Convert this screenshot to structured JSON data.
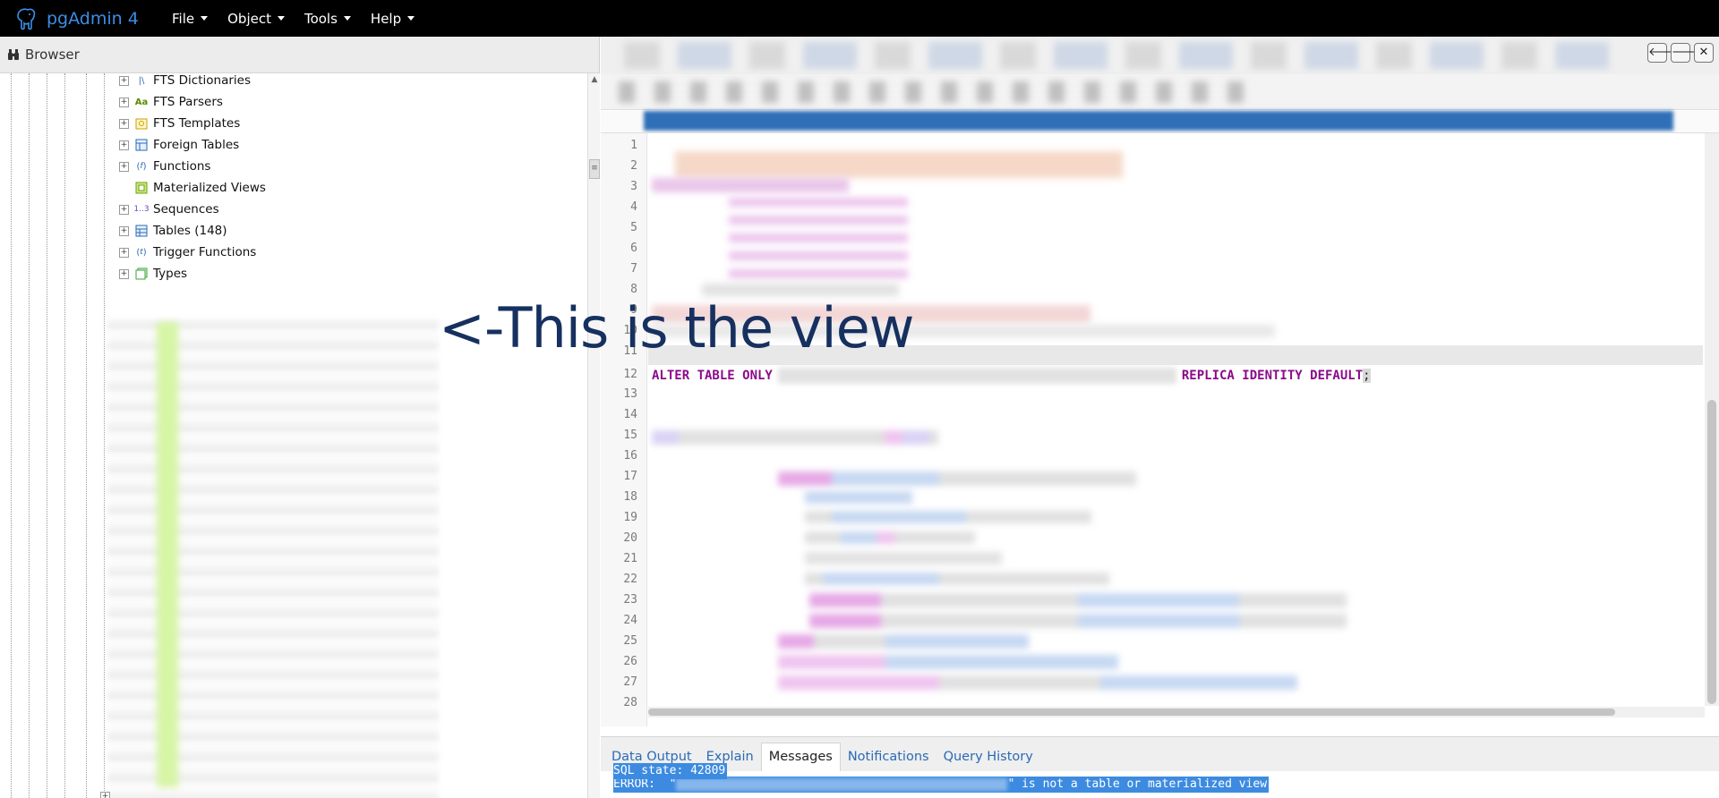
{
  "app": {
    "title": "pgAdmin 4"
  },
  "menu": [
    {
      "label": "File"
    },
    {
      "label": "Object"
    },
    {
      "label": "Tools"
    },
    {
      "label": "Help"
    }
  ],
  "browser": {
    "title": "Browser",
    "tree_items": [
      {
        "label": "FTS Dictionaries",
        "icon": "fts-dictionary-icon"
      },
      {
        "label": "FTS Parsers",
        "icon": "fts-parser-icon"
      },
      {
        "label": "FTS Templates",
        "icon": "fts-template-icon"
      },
      {
        "label": "Foreign Tables",
        "icon": "foreign-table-icon"
      },
      {
        "label": "Functions",
        "icon": "function-icon"
      },
      {
        "label": "Materialized Views",
        "icon": "materialized-view-icon"
      },
      {
        "label": "Sequences",
        "icon": "sequence-icon"
      },
      {
        "label": "Tables (148)",
        "icon": "table-icon"
      },
      {
        "label": "Trigger Functions",
        "icon": "trigger-function-icon"
      },
      {
        "label": "Types",
        "icon": "type-icon"
      }
    ],
    "icon_glyphs": {
      "fts_parser": "Aa",
      "sequence": "1..3"
    }
  },
  "query_tool": {
    "nav_buttons": {
      "back": "🡐",
      "forward": "🡒",
      "close": "✕"
    },
    "line_numbers": [
      "1",
      "2",
      "3",
      "4",
      "5",
      "6",
      "7",
      "8",
      "9",
      "10",
      "11",
      "12",
      "13",
      "14",
      "15",
      "16",
      "17",
      "18",
      "19",
      "20",
      "21",
      "22",
      "23",
      "24",
      "25",
      "26",
      "27",
      "28"
    ],
    "visible_code": {
      "kw1": "ALTER TABLE ONLY",
      "kw2": "REPLICA IDENTITY DEFAULT",
      "end": ";"
    }
  },
  "results": {
    "tabs": [
      {
        "label": "Data Output",
        "active": false
      },
      {
        "label": "Explain",
        "active": false
      },
      {
        "label": "Messages",
        "active": true
      },
      {
        "label": "Notifications",
        "active": false
      },
      {
        "label": "Query History",
        "active": false
      }
    ],
    "message_error_prefix": "ERROR:  \"",
    "message_error_suffix": "\" is not a table or materialized view",
    "message_sql_state": "SQL state: 42809"
  },
  "annotation": {
    "text": "<-This is the view"
  },
  "colors": {
    "navbar_bg": "#000000",
    "brand_blue": "#3b8ee6",
    "keyword": "#8b0a8b",
    "selection": "#3d8be0",
    "annotation": "#16305f"
  }
}
